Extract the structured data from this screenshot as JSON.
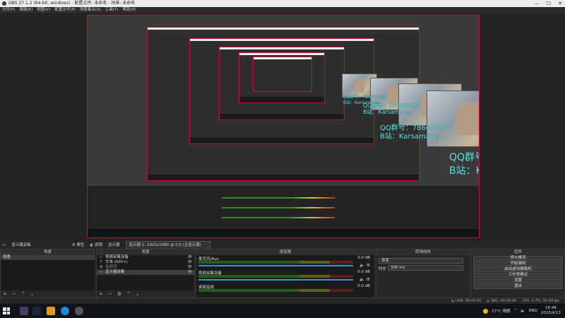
{
  "window": {
    "title": "OBS 27.1.2 (64-bit, windows) - 配置文件: 未命名 - 场景: 未命名",
    "controls": [
      "—",
      "☐",
      "✕"
    ]
  },
  "menu": [
    "文件(F)",
    "编辑(E)",
    "视图(V)",
    "配置文件(P)",
    "场景集合(S)",
    "工具(T)",
    "帮助(H)"
  ],
  "preview": {
    "overlay_line1": "QQ群号：786635574",
    "overlay_line2": "B站：Karsamzing"
  },
  "source_bar": {
    "source": "显示器采集",
    "props": "属性",
    "filters": "滤镜",
    "display_label": "显示器",
    "display_value": "显示器 1: 1920x1080 @ 0,0 (主显示器)"
  },
  "scenes": {
    "header": "场景",
    "items": [
      "场景"
    ]
  },
  "sources": {
    "header": "来源",
    "items": [
      {
        "icon": "▭",
        "name": "视频采集设备"
      },
      {
        "icon": "T",
        "name": "文本 (GDI+)"
      },
      {
        "icon": "◔",
        "name": "音频流"
      },
      {
        "icon": "▭",
        "name": "显示器采集"
      }
    ]
  },
  "mixer": {
    "header": "混音器",
    "channels": [
      {
        "name": "麦克风/Aux",
        "db": "0.0 dB"
      },
      {
        "name": "视频采集设备",
        "db": "0.0 dB"
      },
      {
        "name": "桌面音频",
        "db": "0.0 dB"
      }
    ]
  },
  "transition": {
    "header": "转场特效",
    "selected": "渐变",
    "duration_label": "时长",
    "duration_value": "300 ms"
  },
  "controls": {
    "header": "控件",
    "buttons": [
      "停止推流",
      "开始录制",
      "启动虚拟摄像机",
      "工作室模式",
      "设置",
      "退出"
    ]
  },
  "status": {
    "live": "LIVE: 00:00:00",
    "rec": "REC: 00:00:00",
    "cpu": "CPU: 0.7%, 30.00 fps"
  },
  "tray": {
    "weather": "27°C 晴朗",
    "lang": "ENG",
    "time": "16:48",
    "date": "2022/4/13"
  }
}
